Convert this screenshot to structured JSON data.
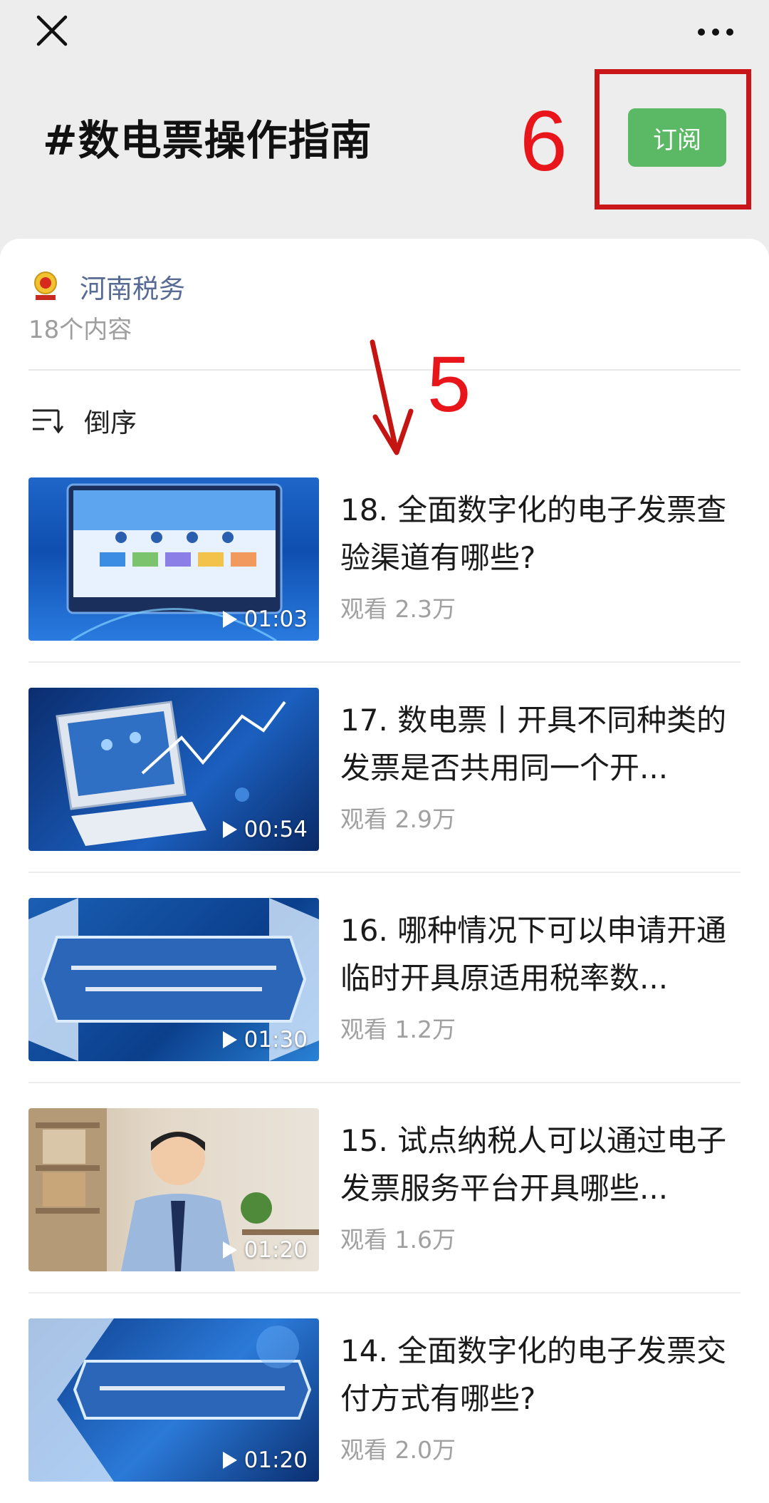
{
  "header": {
    "title": "#数电票操作指南",
    "subscribe_label": "订阅"
  },
  "annotations": {
    "six": "6",
    "five": "5"
  },
  "author": {
    "name": "河南税务",
    "count": "18个内容"
  },
  "sort": {
    "label": "倒序"
  },
  "items": [
    {
      "title": "18. 全面数字化的电子发票查验渠道有哪些?",
      "views": "观看 2.3万",
      "duration": "01:03"
    },
    {
      "title": "17. 数电票丨开具不同种类的发票是否共用同一个开...",
      "views": "观看 2.9万",
      "duration": "00:54"
    },
    {
      "title": "16. 哪种情况下可以申请开通临时开具原适用税率数...",
      "views": "观看 1.2万",
      "duration": "01:30"
    },
    {
      "title": "15. 试点纳税人可以通过电子发票服务平台开具哪些...",
      "views": "观看 1.6万",
      "duration": "01:20"
    },
    {
      "title": "14. 全面数字化的电子发票交付方式有哪些?",
      "views": "观看 2.0万",
      "duration": "01:20"
    }
  ],
  "colors": {
    "accent_green": "#5bb865",
    "annotation_red": "#e8161a",
    "link_blue": "#576b95"
  }
}
